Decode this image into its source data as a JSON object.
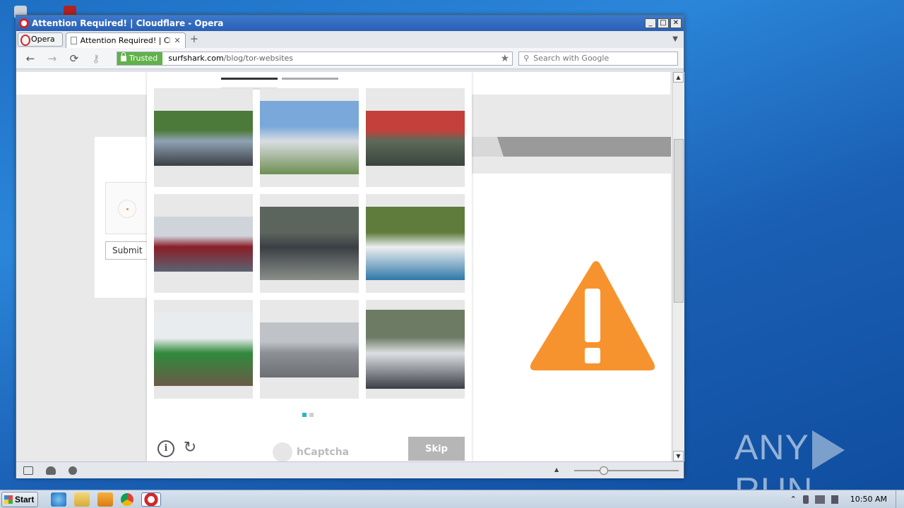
{
  "window": {
    "title": "Attention Required! | Cloudflare - Opera",
    "controls": [
      "_",
      "□",
      "✕"
    ]
  },
  "tabs": {
    "menu_label": "Opera",
    "active_tab_title": "Attention Required! | Clo...",
    "close_glyph": "✕",
    "new_tab_glyph": "+",
    "tab_menu_glyph": "▼"
  },
  "address": {
    "back": "←",
    "forward": "→",
    "reload": "⟳",
    "key": "⚷",
    "trusted_label": "Trusted",
    "url_host": "surfshark.com",
    "url_path": "/blog/tor-websites",
    "bookmark_glyph": "★",
    "search_placeholder": "Search with Google",
    "search_glyph": "⚲"
  },
  "page": {
    "submit_label": "Submit"
  },
  "captcha": {
    "images": [
      {
        "name": "cyclists-race",
        "colors": [
          "#4c7a3a",
          "#8fa2b4",
          "#3b3f45"
        ]
      },
      {
        "name": "propeller-airplane",
        "colors": [
          "#7ba8da",
          "#d9dde1",
          "#6e8f52"
        ]
      },
      {
        "name": "military-trucks",
        "colors": [
          "#c4403a",
          "#5c6a5a",
          "#3a443c"
        ]
      },
      {
        "name": "high-speed-train",
        "colors": [
          "#cfd3da",
          "#8a1e28",
          "#5a6472"
        ]
      },
      {
        "name": "car-rear-wet-road",
        "colors": [
          "#5c655d",
          "#3b3f44",
          "#8a8f8a"
        ]
      },
      {
        "name": "white-sedan-crash",
        "colors": [
          "#5f7c3d",
          "#eceef0",
          "#2e78a8"
        ]
      },
      {
        "name": "delivery-truck",
        "colors": [
          "#e8ecef",
          "#2f8a3c",
          "#6a5a48"
        ]
      },
      {
        "name": "turboprop-plane",
        "colors": [
          "#bfc3c7",
          "#8d9196",
          "#6c6f73"
        ]
      },
      {
        "name": "man-near-bus",
        "colors": [
          "#6d7b65",
          "#dde0e3",
          "#3b3e44"
        ]
      }
    ],
    "pages": [
      true,
      false
    ],
    "info_glyph": "i",
    "refresh_glyph": "↻",
    "brand": "hCaptcha",
    "skip_label": "Skip"
  },
  "warning": {
    "color": "#f7932f",
    "glyph": "!"
  },
  "statusbar": {
    "zoom_up_glyph": "▲"
  },
  "taskbar": {
    "start_label": "Start",
    "time": "10:50 AM"
  },
  "watermark": {
    "left": "ANY",
    "right": "RUN"
  }
}
